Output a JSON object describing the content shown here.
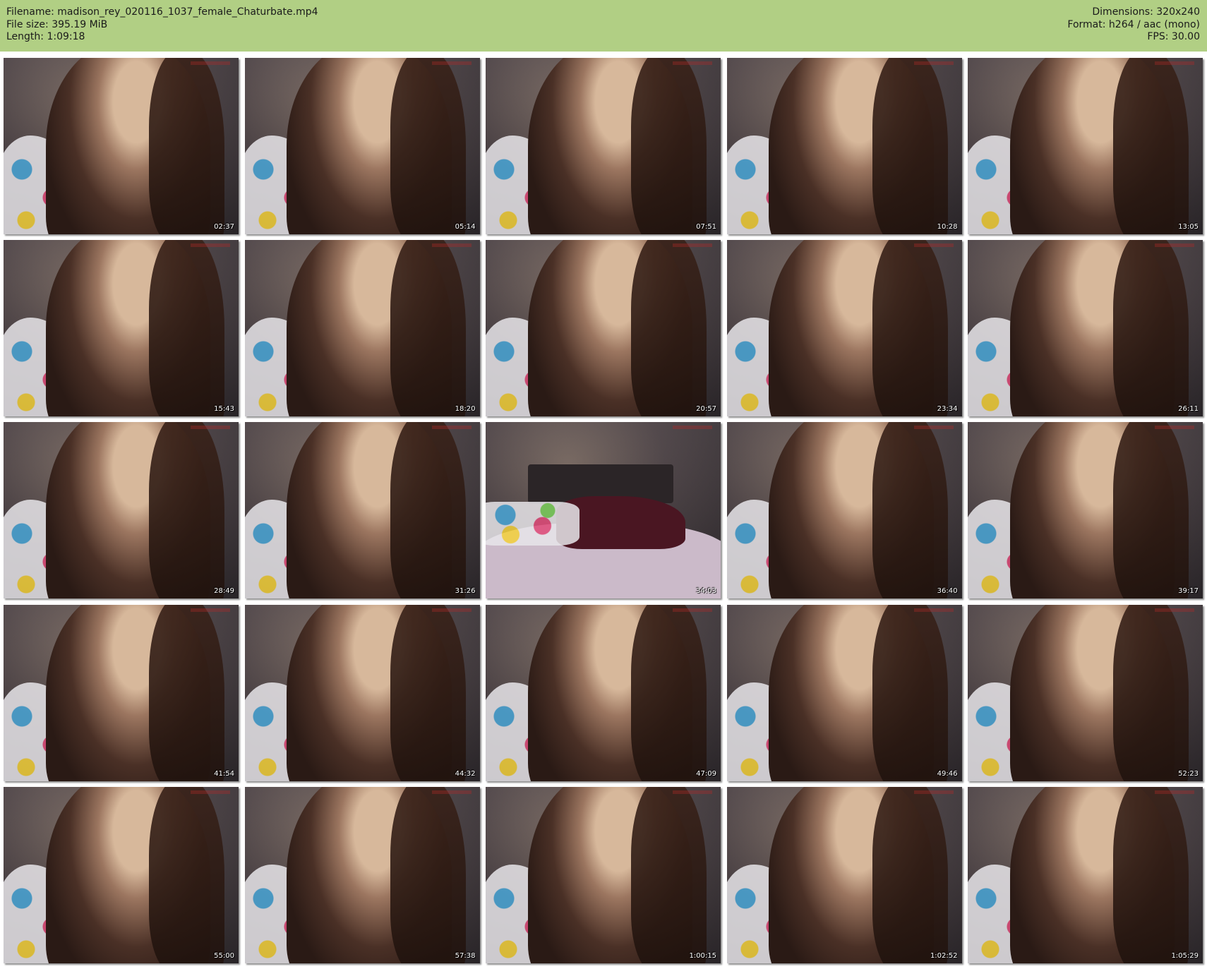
{
  "header": {
    "filename": "Filename: madison_rey_020116_1037_female_Chaturbate.mp4",
    "filesize": "File size: 395.19 MiB",
    "length": "Length: 1:09:18",
    "dimensions": "Dimensions: 320x240",
    "format": "Format: h264 / aac (mono)",
    "fps": "FPS: 30.00"
  },
  "colors": {
    "header_bg": "#b1cf84",
    "page_bg": "#ffffff"
  },
  "thumbnails": [
    {
      "time": "02:37"
    },
    {
      "time": "05:14"
    },
    {
      "time": "07:51"
    },
    {
      "time": "10:28"
    },
    {
      "time": "13:05"
    },
    {
      "time": "15:43"
    },
    {
      "time": "18:20"
    },
    {
      "time": "20:57"
    },
    {
      "time": "23:34"
    },
    {
      "time": "26:11"
    },
    {
      "time": "28:49"
    },
    {
      "time": "31:26"
    },
    {
      "time": "34:03"
    },
    {
      "time": "36:40"
    },
    {
      "time": "39:17"
    },
    {
      "time": "41:54"
    },
    {
      "time": "44:32"
    },
    {
      "time": "47:09"
    },
    {
      "time": "49:46"
    },
    {
      "time": "52:23"
    },
    {
      "time": "55:00"
    },
    {
      "time": "57:38"
    },
    {
      "time": "1:00:15"
    },
    {
      "time": "1:02:52"
    },
    {
      "time": "1:05:29"
    }
  ]
}
